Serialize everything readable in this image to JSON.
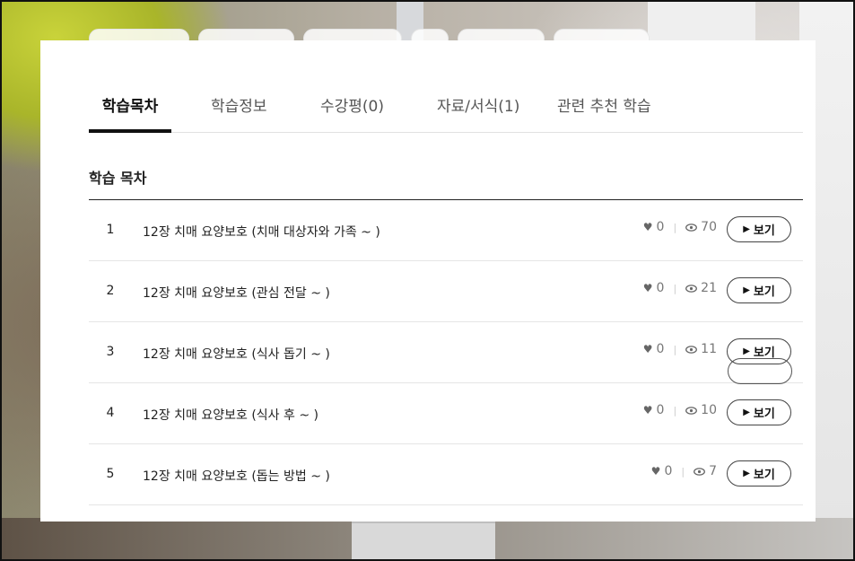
{
  "tabs": [
    {
      "label": "학습목차",
      "active": true
    },
    {
      "label": "학습정보",
      "active": false
    },
    {
      "label": "수강평(0)",
      "active": false
    },
    {
      "label": "자료/서식(1)",
      "active": false
    },
    {
      "label": "관련 추천 학습",
      "active": false
    }
  ],
  "section_title": "학습 목차",
  "view_button_label": "보기",
  "icons": {
    "heart": "heart-icon",
    "eye": "eye-icon",
    "play": "play-icon"
  },
  "lessons": [
    {
      "num": "1",
      "title": "12장 치매 요양보호 (치매 대상자와 가족 ~ )",
      "likes": "0",
      "views": "70"
    },
    {
      "num": "2",
      "title": "12장 치매 요양보호 (관심 전달 ~ )",
      "likes": "0",
      "views": "21"
    },
    {
      "num": "3",
      "title": "12장 치매 요양보호 (식사 돕기 ~ )",
      "likes": "0",
      "views": "11"
    },
    {
      "num": "4",
      "title": "12장 치매 요양보호 (식사 후 ~ )",
      "likes": "0",
      "views": "10"
    },
    {
      "num": "5",
      "title": "12장 치매 요양보호 (돕는 방법 ~ )",
      "likes": "0",
      "views": "7"
    }
  ]
}
